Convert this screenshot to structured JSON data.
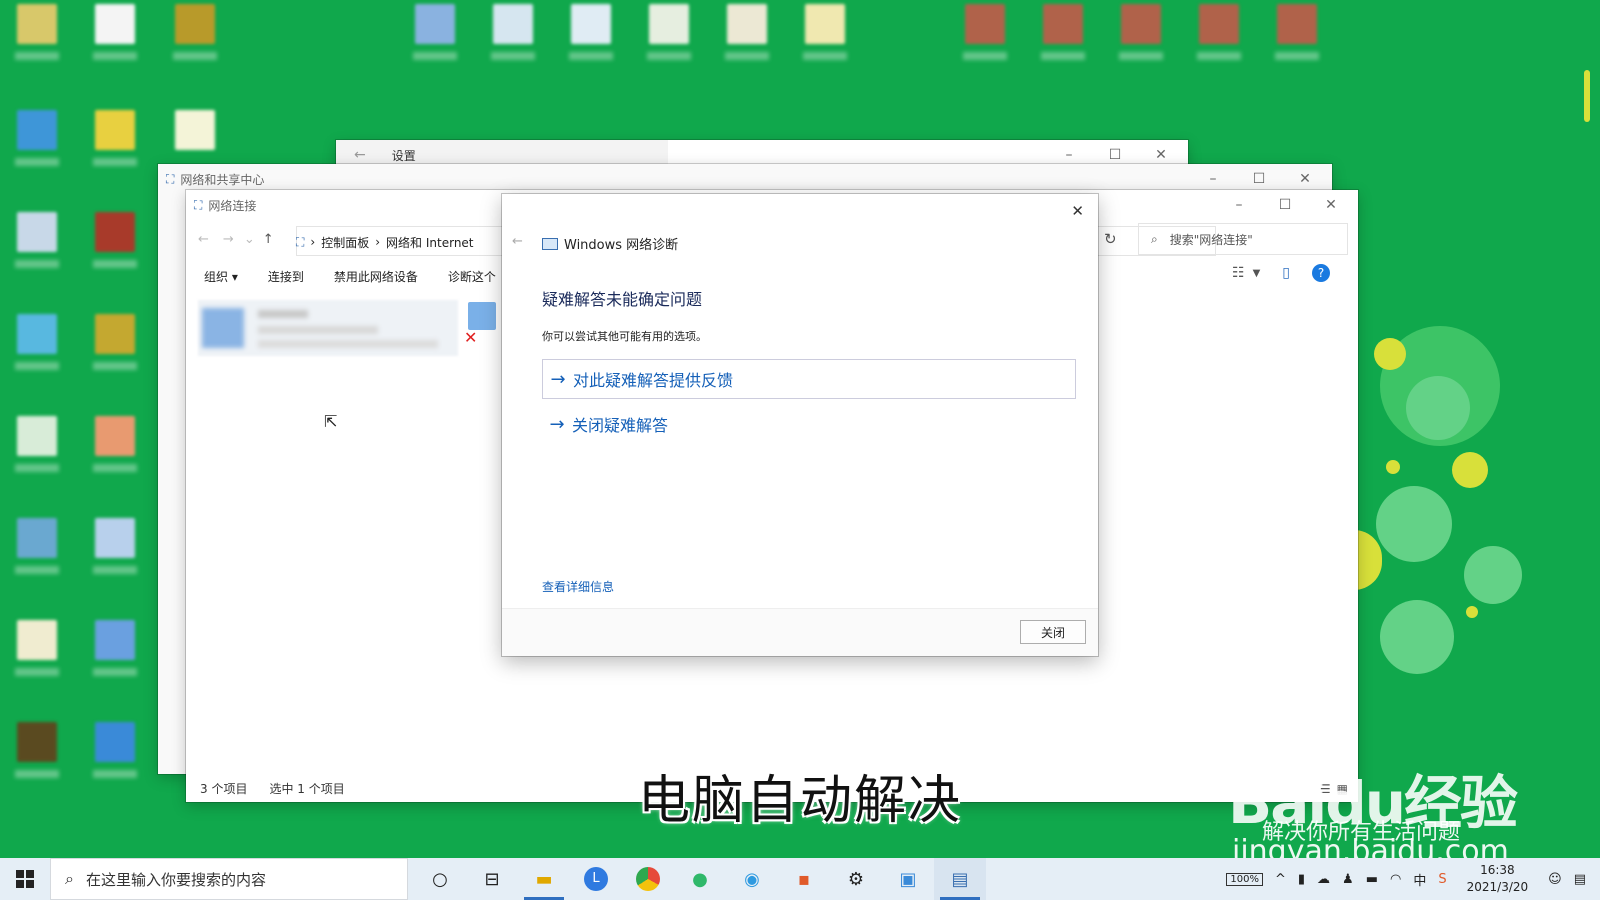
{
  "desktop": {
    "caption": "电脑自动解决",
    "watermark": {
      "logo": "Baidu经验",
      "tagline": "解决你所有生活问题",
      "url": "jingyan.baidu.com"
    }
  },
  "windows": {
    "settings": {
      "title": "设置"
    },
    "network_center": {
      "title": "网络和共享中心"
    },
    "network_connections": {
      "title": "网络连接",
      "breadcrumb": [
        "控制面板",
        "网络和 Internet"
      ],
      "search_placeholder": "搜索\"网络连接\"",
      "toolbar": [
        "组织 ▾",
        "连接到",
        "禁用此网络设备",
        "诊断这个"
      ],
      "status": {
        "items": "3 个项目",
        "selected": "选中 1 个项目"
      }
    }
  },
  "dialog": {
    "title": "Windows 网络诊断",
    "heading": "疑难解答未能确定问题",
    "description": "你可以尝试其他可能有用的选项。",
    "options": [
      "对此疑难解答提供反馈",
      "关闭疑难解答"
    ],
    "details_link": "查看详细信息",
    "close_button": "关闭"
  },
  "taskbar": {
    "search_placeholder": "在这里输入你要搜索的内容",
    "battery": "100%",
    "ime": "中",
    "time": "16:38",
    "date": "2021/3/20"
  },
  "colors": {
    "desktop": "#10a84c",
    "link": "#1560b8",
    "taskbar": "#e5eef6"
  }
}
